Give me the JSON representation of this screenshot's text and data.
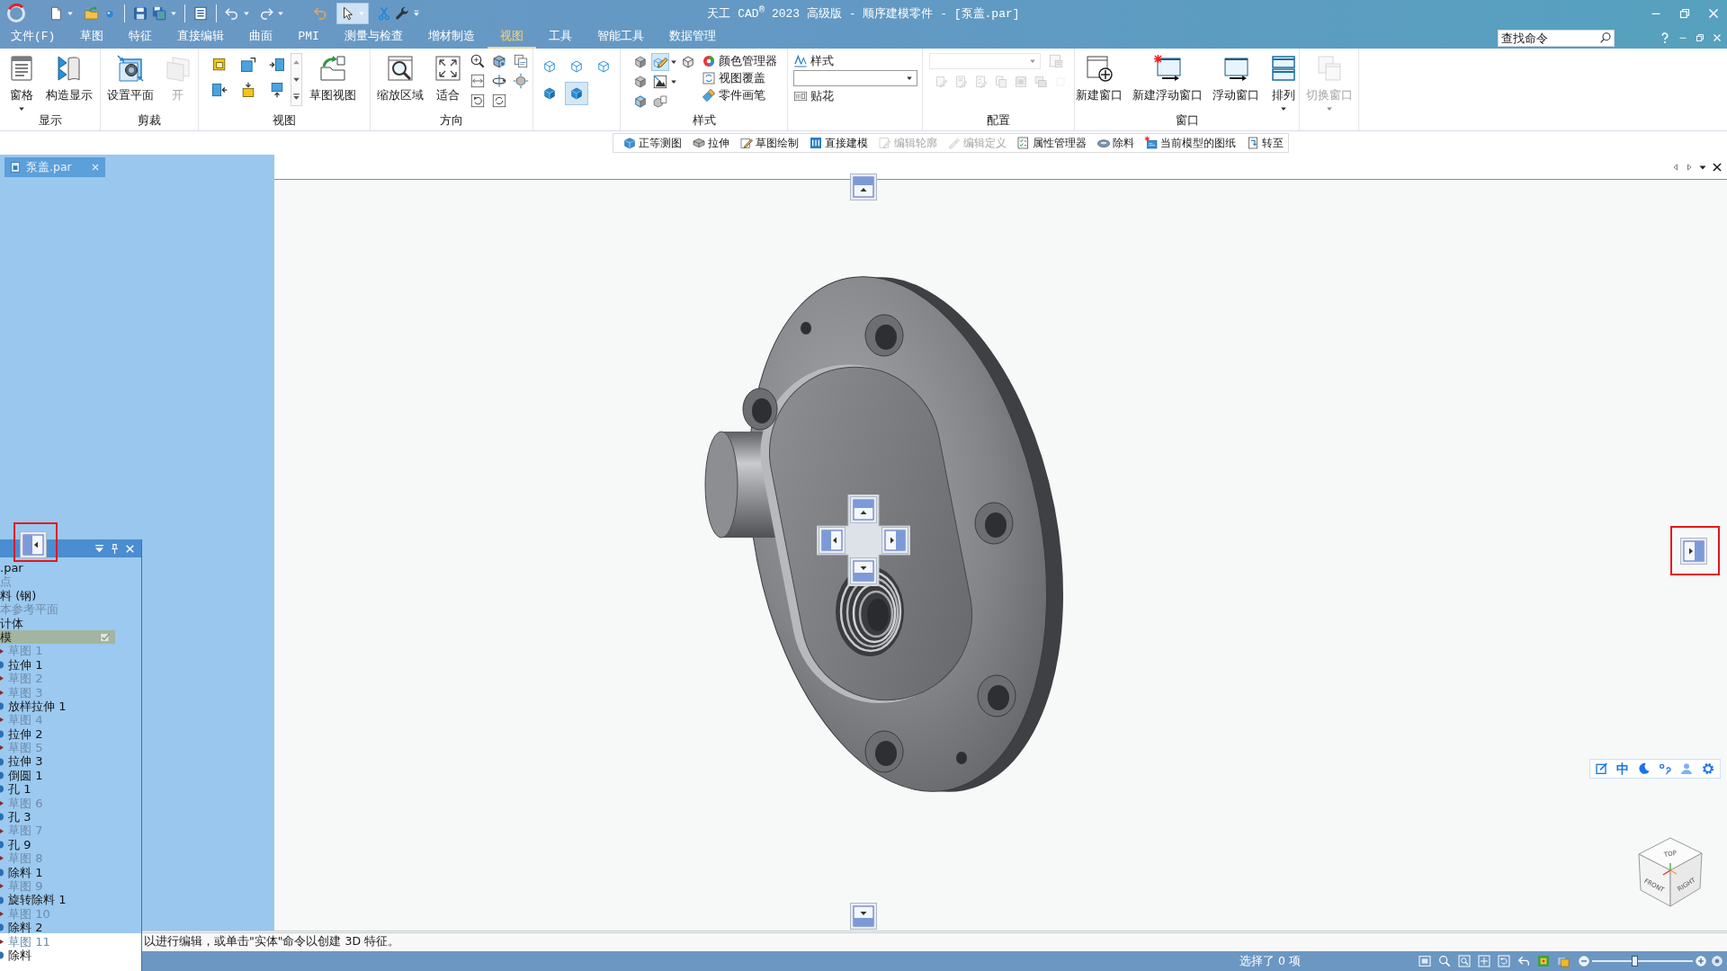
{
  "title_bar": {
    "title": "天工 CAD$^{®}$ 2023 高级版 - 顺序建模零件 - [泵盖.par]"
  },
  "quick_access": {
    "select_tool_active": true
  },
  "menu_tabs": [
    {
      "label": "文件(F)",
      "selected": false
    },
    {
      "label": "草图",
      "selected": false
    },
    {
      "label": "特征",
      "selected": false
    },
    {
      "label": "直接编辑",
      "selected": false
    },
    {
      "label": "曲面",
      "selected": false
    },
    {
      "label": "PMI",
      "selected": false
    },
    {
      "label": "测量与检查",
      "selected": false
    },
    {
      "label": "增材制造",
      "selected": false
    },
    {
      "label": "视图",
      "selected": true
    },
    {
      "label": "工具",
      "selected": false
    },
    {
      "label": "智能工具",
      "selected": false
    },
    {
      "label": "数据管理",
      "selected": false
    }
  ],
  "search": {
    "placeholder": "查找命令"
  },
  "ribbon": [
    {
      "kind": "large",
      "label": "显示",
      "buttons": [
        {
          "label": "窗格",
          "disabled": false
        },
        {
          "label": "构造显示",
          "disabled": false
        }
      ]
    },
    {
      "kind": "large",
      "label": "剪裁",
      "buttons": [
        {
          "label": "设置平面",
          "disabled": false
        },
        {
          "label": "开",
          "disabled": true
        }
      ]
    },
    {
      "kind": "view",
      "label": "视图",
      "buttons": [
        {
          "label": "草图视图",
          "disabled": false
        }
      ]
    },
    {
      "kind": "orient",
      "label": "方向",
      "buttons": [
        {
          "label": "缩放区域",
          "disabled": false
        },
        {
          "label": "适合",
          "disabled": false
        }
      ]
    },
    {
      "kind": "modes",
      "tools": [
        {
          "selected": false
        },
        {
          "selected": false
        },
        {
          "selected": false
        },
        {
          "selected": false
        },
        {
          "selected": true
        }
      ]
    },
    {
      "kind": "style",
      "label": "样式",
      "tools": [
        {
          "selected": false
        },
        {
          "selected": false
        },
        {
          "selected": false
        },
        {
          "selected": true
        },
        {
          "selected": false
        },
        {
          "selected": false
        },
        {
          "selected": false
        }
      ],
      "commands": [
        "颜色管理器",
        "视图覆盖",
        "零件画笔"
      ]
    },
    {
      "kind": "decal",
      "style": "样式",
      "decal": "贴花"
    },
    {
      "kind": "config",
      "label": "配置",
      "disabled": true
    },
    {
      "kind": "large",
      "label": "窗口",
      "buttons": [
        {
          "label": "新建窗口",
          "disabled": false
        },
        {
          "label": "新建浮动窗口",
          "disabled": false
        },
        {
          "label": "浮动窗口",
          "disabled": false
        },
        {
          "label": "排列",
          "disabled": false
        }
      ]
    },
    {
      "kind": "large",
      "buttons": [
        {
          "label": "切换窗口",
          "disabled": true
        }
      ]
    }
  ],
  "command_bar": [
    {
      "label": "正等测图",
      "disabled": false
    },
    {
      "label": "拉伸",
      "disabled": false
    },
    {
      "label": "草图绘制",
      "disabled": false
    },
    {
      "label": "直接建模",
      "disabled": false
    },
    {
      "label": "编辑轮廓",
      "disabled": true
    },
    {
      "label": "编辑定义",
      "disabled": true
    },
    {
      "label": "属性管理器",
      "disabled": false
    },
    {
      "label": "除料",
      "disabled": false
    },
    {
      "label": "当前模型的图纸",
      "disabled": false
    },
    {
      "label": "转至",
      "disabled": false
    }
  ],
  "document_tab": {
    "label": "泵盖.par",
    "selected": true
  },
  "dock_guides": [
    {
      "kind": "top",
      "highlighted": false
    },
    {
      "kind": "bottom",
      "highlighted": false
    },
    {
      "kind": "left",
      "highlighted": true
    },
    {
      "kind": "right",
      "highlighted": true
    }
  ],
  "pathfinder": {
    "items": [
      {
        "label": ".par",
        "kind": "node",
        "dimmed": false,
        "selected": false
      },
      {
        "label": "点",
        "kind": "node",
        "dimmed": true,
        "selected": false
      },
      {
        "label": "料 (钢)",
        "kind": "node",
        "dimmed": false,
        "selected": false
      },
      {
        "label": "本参考平面",
        "kind": "node",
        "dimmed": true,
        "selected": false
      },
      {
        "label": "计体",
        "kind": "node",
        "dimmed": false,
        "selected": false
      },
      {
        "label": "模",
        "kind": "node",
        "dimmed": false,
        "selected": true
      },
      {
        "label": "草图 1",
        "kind": "sketch",
        "dimmed": true,
        "selected": false
      },
      {
        "label": "拉伸 1",
        "kind": "feature",
        "dimmed": false,
        "selected": false
      },
      {
        "label": "草图 2",
        "kind": "sketch",
        "dimmed": true,
        "selected": false
      },
      {
        "label": "草图 3",
        "kind": "sketch",
        "dimmed": true,
        "selected": false
      },
      {
        "label": "放样拉伸 1",
        "kind": "feature",
        "dimmed": false,
        "selected": false
      },
      {
        "label": "草图 4",
        "kind": "sketch",
        "dimmed": true,
        "selected": false
      },
      {
        "label": "拉伸 2",
        "kind": "feature",
        "dimmed": false,
        "selected": false
      },
      {
        "label": "草图 5",
        "kind": "sketch",
        "dimmed": true,
        "selected": false
      },
      {
        "label": "拉伸 3",
        "kind": "feature",
        "dimmed": false,
        "selected": false
      },
      {
        "label": "倒圆 1",
        "kind": "feature",
        "dimmed": false,
        "selected": false
      },
      {
        "label": "孔 1",
        "kind": "feature",
        "dimmed": false,
        "selected": false
      },
      {
        "label": "草图 6",
        "kind": "sketch",
        "dimmed": true,
        "selected": false
      },
      {
        "label": "孔 3",
        "kind": "feature",
        "dimmed": false,
        "selected": false
      },
      {
        "label": "草图 7",
        "kind": "sketch",
        "dimmed": true,
        "selected": false
      },
      {
        "label": "孔 9",
        "kind": "feature",
        "dimmed": false,
        "selected": false
      },
      {
        "label": "草图 8",
        "kind": "sketch",
        "dimmed": true,
        "selected": false
      },
      {
        "label": "除料 1",
        "kind": "feature",
        "dimmed": false,
        "selected": false
      },
      {
        "label": "草图 9",
        "kind": "sketch",
        "dimmed": true,
        "selected": false
      },
      {
        "label": "旋转除料 1",
        "kind": "feature",
        "dimmed": false,
        "selected": false
      },
      {
        "label": "草图 10",
        "kind": "sketch",
        "dimmed": true,
        "selected": false
      },
      {
        "label": "除料 2",
        "kind": "feature",
        "dimmed": false,
        "selected": false
      },
      {
        "label": "草图 11",
        "kind": "sketch",
        "dimmed": true,
        "selected": false
      },
      {
        "label": "除料",
        "kind": "feature",
        "dimmed": false,
        "selected": false
      }
    ]
  },
  "ime_toolbar": {
    "mode": "中"
  },
  "view_cube": {
    "labels": [
      "TOP",
      "FRONT",
      "RIGHT"
    ]
  },
  "prompt": "以进行编辑，或单击\"实体\"命令以创建 3D 特征。",
  "status_bar": {
    "selection": "选择了 0 项",
    "zoom_slider": {
      "level": 0.42
    }
  }
}
